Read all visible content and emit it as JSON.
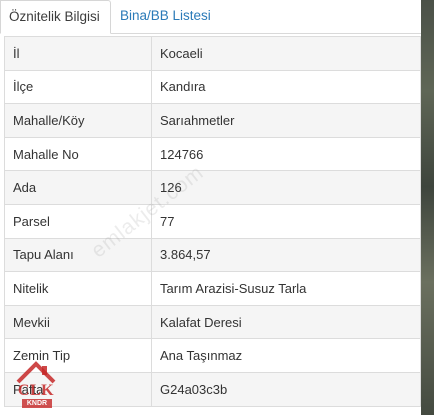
{
  "tabs": [
    {
      "label": "Öznitelik Bilgisi",
      "active": true
    },
    {
      "label": "Bina/BB Listesi",
      "active": false
    }
  ],
  "rows": [
    {
      "key": "İl",
      "value": "Kocaeli"
    },
    {
      "key": "İlçe",
      "value": "Kandıra"
    },
    {
      "key": "Mahalle/Köy",
      "value": "Sarıahmetler"
    },
    {
      "key": "Mahalle No",
      "value": "124766"
    },
    {
      "key": "Ada",
      "value": "126"
    },
    {
      "key": "Parsel",
      "value": "77"
    },
    {
      "key": "Tapu Alanı",
      "value": "3.864,57"
    },
    {
      "key": "Nitelik",
      "value": "Tarım Arazisi-Susuz Tarla"
    },
    {
      "key": "Mevkii",
      "value": "Kalafat Deresi"
    },
    {
      "key": "Zemin Tip",
      "value": "Ana Taşınmaz"
    },
    {
      "key": "Pafta",
      "value": "G24a03c3b"
    }
  ],
  "watermark": "emlakjet.com",
  "logo": {
    "text": "CLK",
    "sub": "KNDR"
  },
  "colors": {
    "tab_link": "#2a7ab8",
    "row_alt": "#f5f5f5",
    "border": "#dcdcdc",
    "logo_red": "#c62828"
  }
}
